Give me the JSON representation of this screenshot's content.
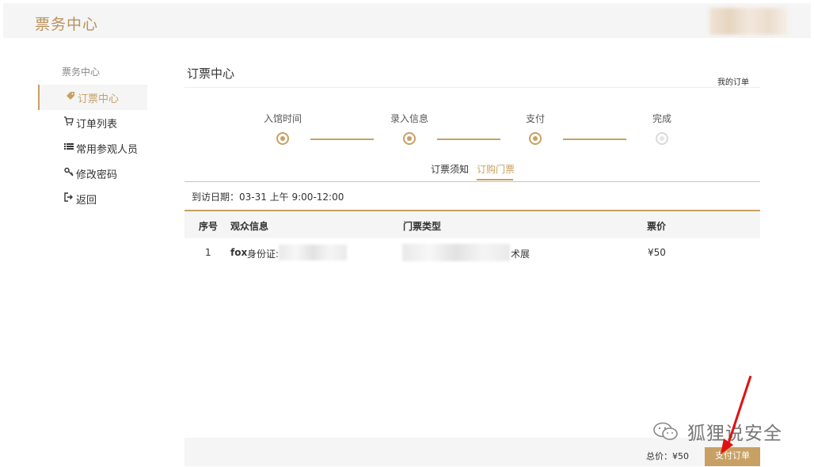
{
  "header": {
    "brand": "票务中心"
  },
  "sidebar": {
    "heading": "票务中心",
    "items": [
      {
        "label": "订票中心",
        "icon": "tag-icon",
        "active": true
      },
      {
        "label": "订单列表",
        "icon": "cart-icon"
      },
      {
        "label": "常用参观人员",
        "icon": "list-icon"
      },
      {
        "label": "修改密码",
        "icon": "key-icon"
      },
      {
        "label": "返回",
        "icon": "sign-out-icon"
      }
    ]
  },
  "main": {
    "title": "订票中心",
    "my_orders_link": "我的订单",
    "steps": [
      {
        "label": "入馆时间",
        "state": "done"
      },
      {
        "label": "录入信息",
        "state": "done"
      },
      {
        "label": "支付",
        "state": "done"
      },
      {
        "label": "完成",
        "state": "pending"
      }
    ],
    "tabs": [
      {
        "label": "订票须知"
      },
      {
        "label": "订购门票",
        "active": true
      }
    ],
    "visit_date": "到访日期：03-31 上午 9:00-12:00",
    "table": {
      "headers": [
        "序号",
        "观众信息",
        "门票类型",
        "票价"
      ],
      "rows": [
        {
          "index": "1",
          "visitor_name": "fox",
          "visitor_id_label": "身份证:",
          "ticket_type_suffix": "术展",
          "price": "¥50"
        }
      ]
    },
    "footer": {
      "total": "总价：¥50",
      "pay_button": "支付订单"
    }
  },
  "watermark": {
    "text": "狐狸说安全"
  },
  "colors": {
    "accent": "#c8a063",
    "brand": "#b8915a",
    "panel": "#f5f5f5"
  }
}
